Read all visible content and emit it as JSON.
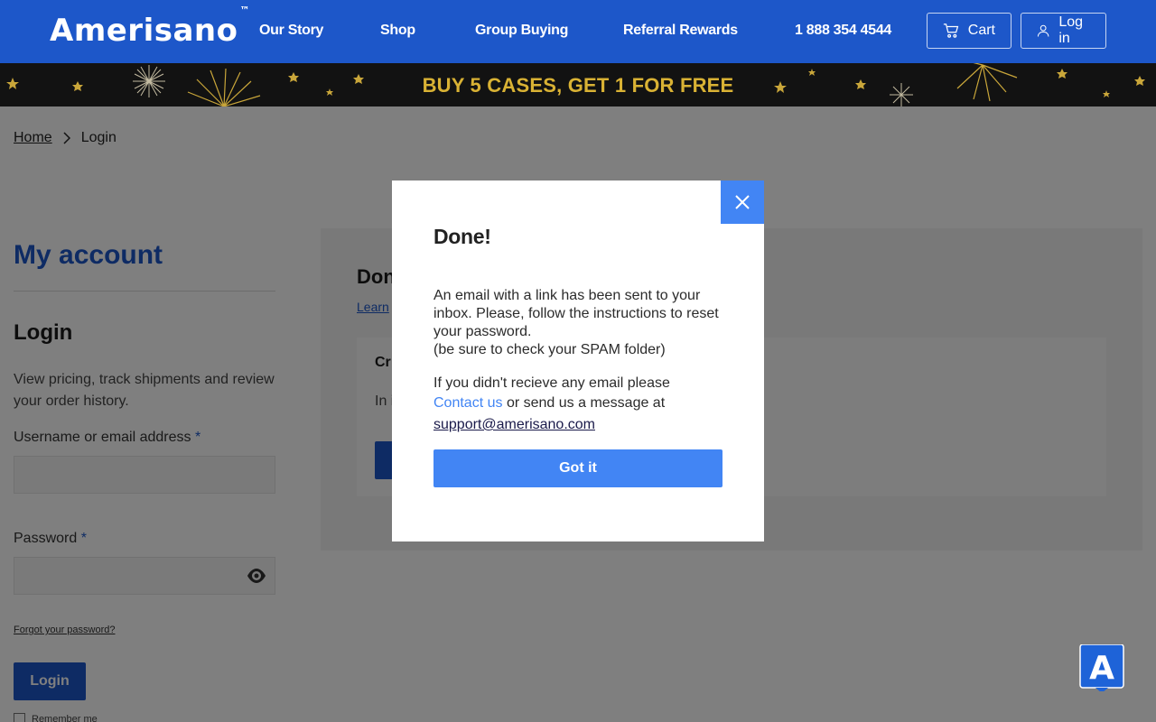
{
  "header": {
    "logo": "Amerisano",
    "trademark": "™",
    "nav": [
      "Our Story",
      "Shop",
      "Group Buying",
      "Referral Rewards",
      "1 888 354 4544"
    ],
    "cart_label": "Cart",
    "login_label": "Log in"
  },
  "promo": {
    "text": "BUY 5 CASES, GET 1 FOR FREE"
  },
  "breadcrumb": {
    "home": "Home",
    "current": "Login"
  },
  "sidebar": {
    "title": "My account",
    "login_heading": "Login",
    "description": "View pricing, track shipments and review your order history.",
    "username_label": "Username or email address",
    "password_label": "Password",
    "required_mark": "*",
    "forgot": "Forgot your password?",
    "login_button": "Login",
    "remember": "Remember me"
  },
  "panel": {
    "title_fragment": "Don",
    "link_fragment": "Learn",
    "card_title_fragment": "Cr",
    "card_text_fragment": "In                                                                                  it and view your orders, shipping, and billing ad"
  },
  "modal": {
    "title": "Done!",
    "message": "An email with a link has been sent to your inbox. Please, follow the instructions to reset your password.",
    "spam_note": "(be sure to check your SPAM folder)",
    "no_email_prefix": "If you didn't recieve any email please",
    "contact_link": "Contact us",
    "no_email_suffix": "or send us a message at",
    "email": "support@amerisano.com",
    "button": "Got it"
  },
  "chat_badge": {
    "letter": "A"
  },
  "colors": {
    "brand_blue": "#1d57c9",
    "modal_blue": "#4285f4",
    "promo_gold": "#d9b234",
    "promo_bg": "#121212"
  }
}
